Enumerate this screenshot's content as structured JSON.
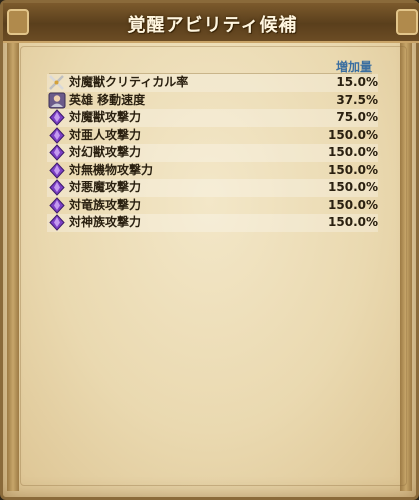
{
  "window": {
    "title": "覚醒アビリティ候補"
  },
  "table": {
    "column_header": "増加量",
    "rows": [
      {
        "icon": "crossed-swords-icon",
        "label": "対魔獣クリティカル率",
        "value": "15.0%"
      },
      {
        "icon": "hero-portrait-icon",
        "label": "英雄 移動速度",
        "value": "37.5%"
      },
      {
        "icon": "purple-crystal-icon",
        "label": "対魔獣攻撃力",
        "value": "75.0%"
      },
      {
        "icon": "purple-crystal-icon",
        "label": "対亜人攻撃力",
        "value": "150.0%"
      },
      {
        "icon": "purple-crystal-icon",
        "label": "対幻獣攻撃力",
        "value": "150.0%"
      },
      {
        "icon": "purple-crystal-icon",
        "label": "対無機物攻撃力",
        "value": "150.0%"
      },
      {
        "icon": "purple-crystal-icon",
        "label": "対悪魔攻撃力",
        "value": "150.0%"
      },
      {
        "icon": "purple-crystal-icon",
        "label": "対竜族攻撃力",
        "value": "150.0%"
      },
      {
        "icon": "purple-crystal-icon",
        "label": "対神族攻撃力",
        "value": "150.0%"
      }
    ]
  },
  "colors": {
    "header_text": "#3a6ea0",
    "parchment": "#ead9b0",
    "frame": "#8a6a3a",
    "crystal": "#7b3fc4"
  }
}
